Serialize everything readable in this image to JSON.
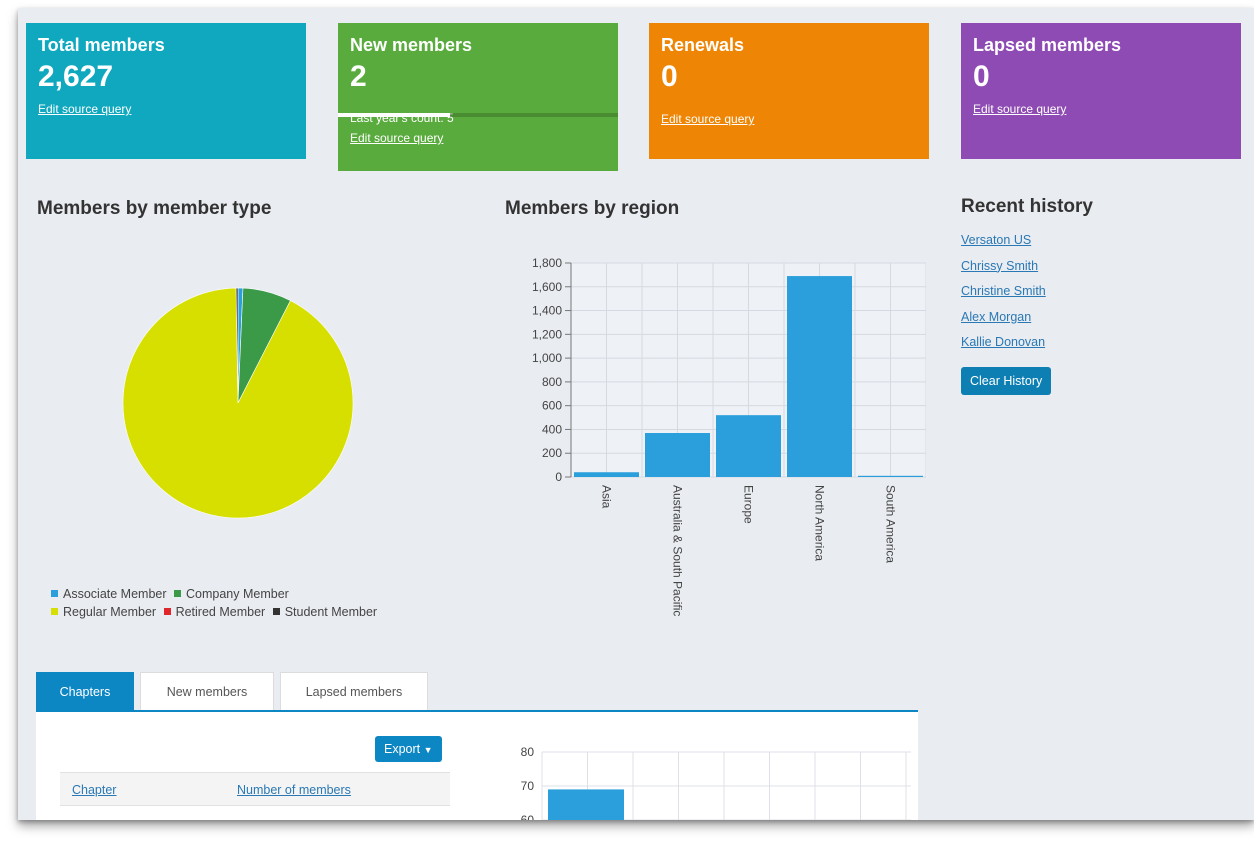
{
  "tiles": {
    "total": {
      "title": "Total members",
      "value": "2,627",
      "link": "Edit source query",
      "color": "#0fa8bf"
    },
    "new": {
      "title": "New members",
      "value": "2",
      "subtext": "Last year's count: 5",
      "link": "Edit source query",
      "progress_fraction": 0.4,
      "color": "#5aab3e"
    },
    "renewals": {
      "title": "Renewals",
      "value": "0",
      "link": "Edit source query",
      "color": "#ee8505"
    },
    "lapsed": {
      "title": "Lapsed members",
      "value": "0",
      "link": "Edit source query",
      "color": "#8e4bb3"
    }
  },
  "sections": {
    "member_type": "Members by member type",
    "region": "Members by region",
    "history": "Recent history"
  },
  "member_type_chart": {
    "type": "pie",
    "slices": [
      {
        "label": "Associate Member",
        "value": 18,
        "color": "#2a9fdc"
      },
      {
        "label": "Company Member",
        "value": 180,
        "color": "#3b9a48"
      },
      {
        "label": "Regular Member",
        "value": 2422,
        "color": "#d6df00"
      },
      {
        "label": "Retired Member",
        "value": 0,
        "color": "#e0252b"
      },
      {
        "label": "Student Member",
        "value": 7,
        "color": "#333333"
      }
    ]
  },
  "chart_data": {
    "type": "bar",
    "categories": [
      "Asia",
      "Australia & South Pacific",
      "Europe",
      "North America",
      "South America"
    ],
    "values": [
      40,
      370,
      520,
      1690,
      10
    ],
    "ylim": [
      0,
      1800
    ],
    "yticks": [
      "0",
      "200",
      "400",
      "600",
      "800",
      "1,000",
      "1,200",
      "1,400",
      "1,600",
      "1,800"
    ],
    "grid": true,
    "color": "#2a9fdc"
  },
  "history": {
    "items": [
      "Versaton US",
      "Chrissy Smith",
      "Christine Smith",
      "Alex Morgan",
      "Kallie Donovan"
    ],
    "clear_label": "Clear History"
  },
  "tabs": [
    "Chapters",
    "New members",
    "Lapsed members"
  ],
  "panel": {
    "export_label": "Export",
    "columns": [
      "Chapter",
      "Number of members"
    ]
  },
  "chapters_chart": {
    "type": "bar",
    "yticks": [
      "80",
      "70",
      "60"
    ],
    "values": [
      69
    ],
    "ylim": [
      60,
      80
    ]
  }
}
